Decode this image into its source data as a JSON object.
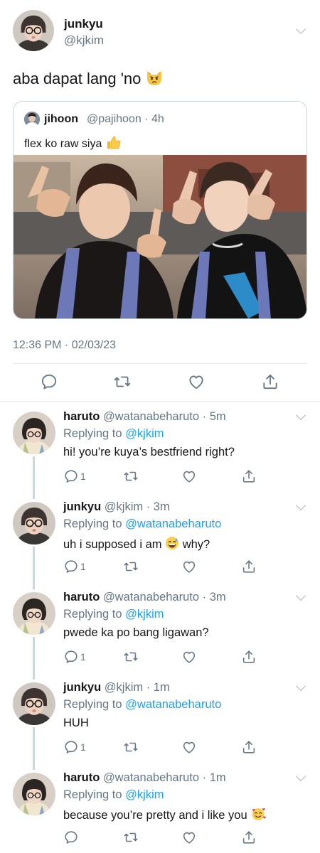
{
  "main_tweet": {
    "name": "junkyu",
    "handle": "@kjkim",
    "text": "aba dapat lang 'no",
    "text_emoji": "pouting-cat-icon",
    "timestamp": "12:36 PM · 02/03/23",
    "quote": {
      "name": "jihoon",
      "handle": "@pajihoon",
      "time": "· 4h",
      "text": "flex ko raw siya",
      "text_emoji": "thumbs-up-icon"
    },
    "actions": [
      "reply-icon",
      "retweet-icon",
      "like-icon",
      "share-icon"
    ]
  },
  "replies": [
    {
      "name": "haruto",
      "meta": "@watanabeharuto · 5m",
      "replying_prefix": "Replying to",
      "replying_to": "@kjkim",
      "text": "hi! you’re kuya’s bestfriend right?",
      "reply_count": "1"
    },
    {
      "name": "junkyu",
      "meta": "@kjkim · 3m",
      "replying_prefix": "Replying to",
      "replying_to": "@watanabeharuto",
      "text": "uh i supposed i am",
      "text_after": "why?",
      "text_emoji": "sweat-smile-icon",
      "reply_count": "1"
    },
    {
      "name": "haruto",
      "meta": "@watanabeharuto · 3m",
      "replying_prefix": "Replying to",
      "replying_to": "@kjkim",
      "text": "pwede ka po bang ligawan?",
      "reply_count": "1"
    },
    {
      "name": "junkyu",
      "meta": "@kjkim · 1m",
      "replying_prefix": "Replying to",
      "replying_to": "@watanabeharuto",
      "text": "HUH",
      "reply_count": "1"
    },
    {
      "name": "haruto",
      "meta": "@watanabeharuto · 1m",
      "replying_prefix": "Replying to",
      "replying_to": "@kjkim",
      "text": "because you’re pretty and i like you",
      "text_emoji": "smiling-face-with-hearts-icon",
      "reply_count": ""
    }
  ],
  "colors": {
    "text": "#14171a",
    "secondary": "#657786",
    "link": "#1da1f2",
    "border": "#e6ecf0",
    "icon": "#657786"
  }
}
